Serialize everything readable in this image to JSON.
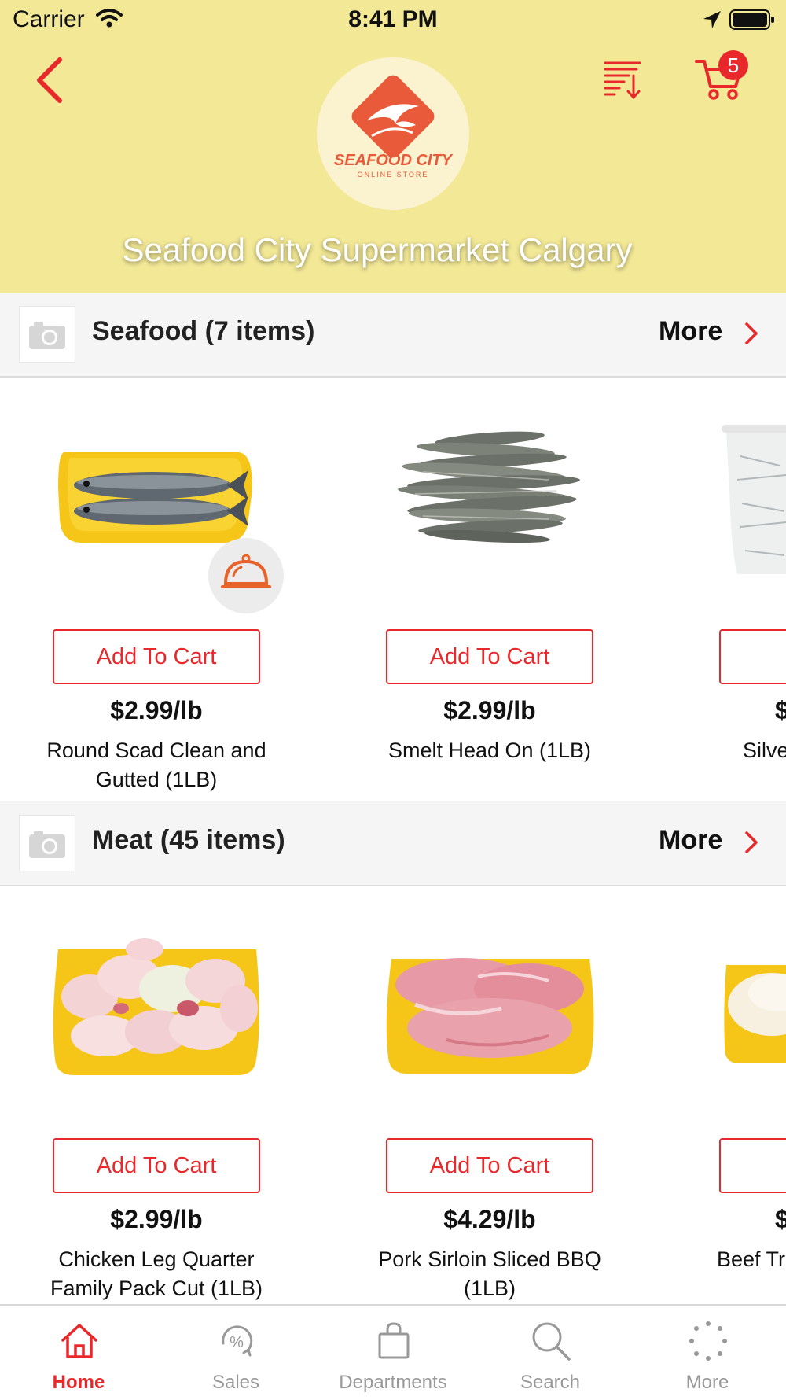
{
  "status_bar": {
    "carrier": "Carrier",
    "time": "8:41 PM"
  },
  "header": {
    "store_name": "Seafood City Supermarket Calgary",
    "cart_count": "5",
    "logo_line1": "SEAFOOD CITY",
    "logo_line2": "ONLINE STORE"
  },
  "sections": [
    {
      "title": "Seafood (7 items)",
      "more_label": "More",
      "products": [
        {
          "add_label": "Add To Cart",
          "price": "$2.99/lb",
          "name": "Round Scad Clean and Gutted (1LB)"
        },
        {
          "add_label": "Add To Cart",
          "price": "$2.99/lb",
          "name": "Smelt Head On (1LB)"
        },
        {
          "add_label": "Ad",
          "price": "$",
          "name": "Silve"
        }
      ]
    },
    {
      "title": "Meat (45 items)",
      "more_label": "More",
      "products": [
        {
          "add_label": "Add To Cart",
          "price": "$2.99/lb",
          "name": "Chicken Leg Quarter Family Pack Cut (1LB)"
        },
        {
          "add_label": "Add To Cart",
          "price": "$4.29/lb",
          "name": "Pork Sirloin Sliced BBQ (1LB)"
        },
        {
          "add_label": "Ac",
          "price": "$",
          "name": "Beef Tr"
        }
      ]
    }
  ],
  "tabs": [
    {
      "label": "Home",
      "icon": "home-icon",
      "active": true
    },
    {
      "label": "Sales",
      "icon": "percent-tag-icon",
      "active": false
    },
    {
      "label": "Departments",
      "icon": "shopping-bag-icon",
      "active": false
    },
    {
      "label": "Search",
      "icon": "search-icon",
      "active": false
    },
    {
      "label": "More",
      "icon": "more-dots-icon",
      "active": false
    }
  ],
  "colors": {
    "accent": "#e8282b",
    "header_bg": "#f2e896",
    "tray_yellow": "#f5c518",
    "inactive": "#999999"
  }
}
